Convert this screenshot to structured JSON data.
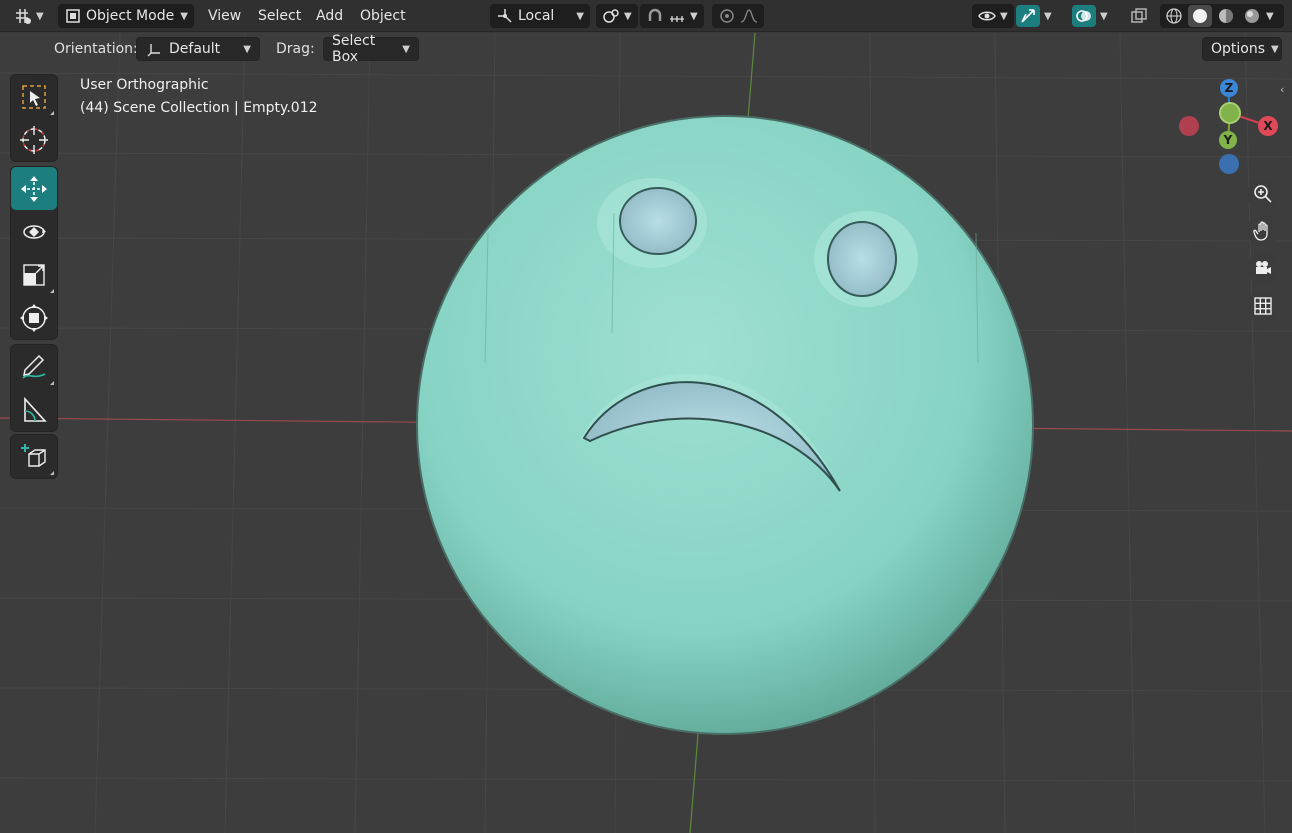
{
  "header": {
    "editor_type_icon": "grid-editor-icon",
    "mode": "Object Mode",
    "menus": [
      "View",
      "Select",
      "Add",
      "Object"
    ],
    "transform_orientation": "Local",
    "options_label": "Options"
  },
  "tool_settings": {
    "orientation_label": "Orientation:",
    "orientation_value": "Default",
    "drag_label": "Drag:",
    "drag_value": "Select Box"
  },
  "viewport": {
    "view_name": "User Orthographic",
    "collection_info": "(44) Scene Collection | Empty.012",
    "gizmo_axes": {
      "x": "X",
      "y": "Y",
      "z": "Z"
    },
    "object_color": "#7ecdc0",
    "background_color": "#3d3d3d"
  },
  "toolbar_left": [
    "select-box-icon",
    "cursor-icon",
    "move-icon",
    "rotate-icon",
    "scale-icon",
    "transform-icon",
    "annotate-icon",
    "measure-icon",
    "add-cube-icon"
  ],
  "nav_buttons": [
    "zoom-icon",
    "pan-hand-icon",
    "camera-icon",
    "perspective-grid-icon"
  ]
}
